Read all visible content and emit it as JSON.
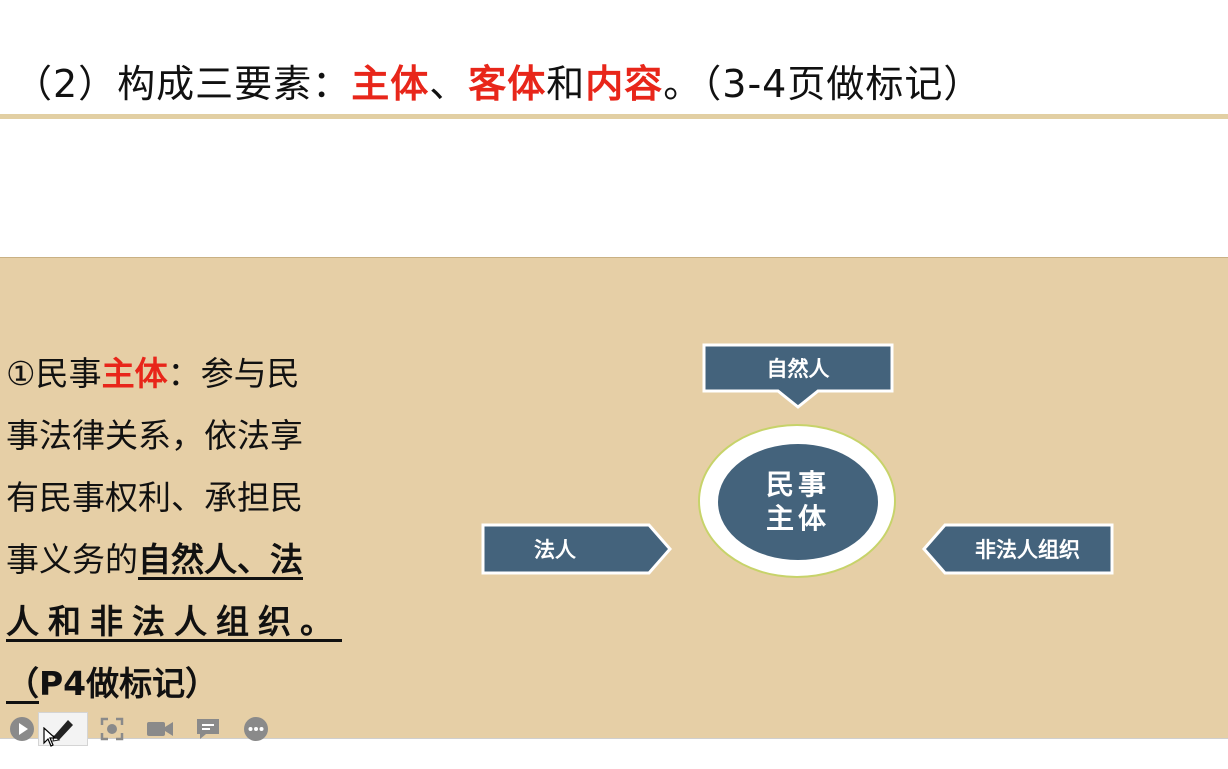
{
  "heading": {
    "prefix": "（2）构成三要素：",
    "term1": "主体",
    "sep1": "、",
    "term2": "客体",
    "sep2": "和",
    "term3": "内容",
    "suffix": "。（3-4页做标记）"
  },
  "body": {
    "line1_pre": "①民事",
    "line1_red": "主体",
    "line1_post": "：参与民",
    "line2": "事法律关系，依法享",
    "line3": "有民事权利、承担民",
    "line4_pre": "事义务的",
    "line4_ul": "自然人、法",
    "line5_ul": "人和非法人组织。",
    "line6_ul": "（",
    "line6_bold": "P4做标记）"
  },
  "diagram": {
    "center_line1": "民事",
    "center_line2": "主体",
    "top_label": "自然人",
    "left_label": "法人",
    "right_label": "非法人组织",
    "shape_fill": "#44637c",
    "circle_ring": "#c7d36a"
  },
  "toolbar": {
    "icons": [
      "play-icon",
      "pen-icon",
      "screenshot-icon",
      "camera-icon",
      "comment-icon",
      "more-icon"
    ]
  },
  "colors": {
    "accent_red": "#e8261a",
    "panel_bg": "#e6cfa6"
  }
}
